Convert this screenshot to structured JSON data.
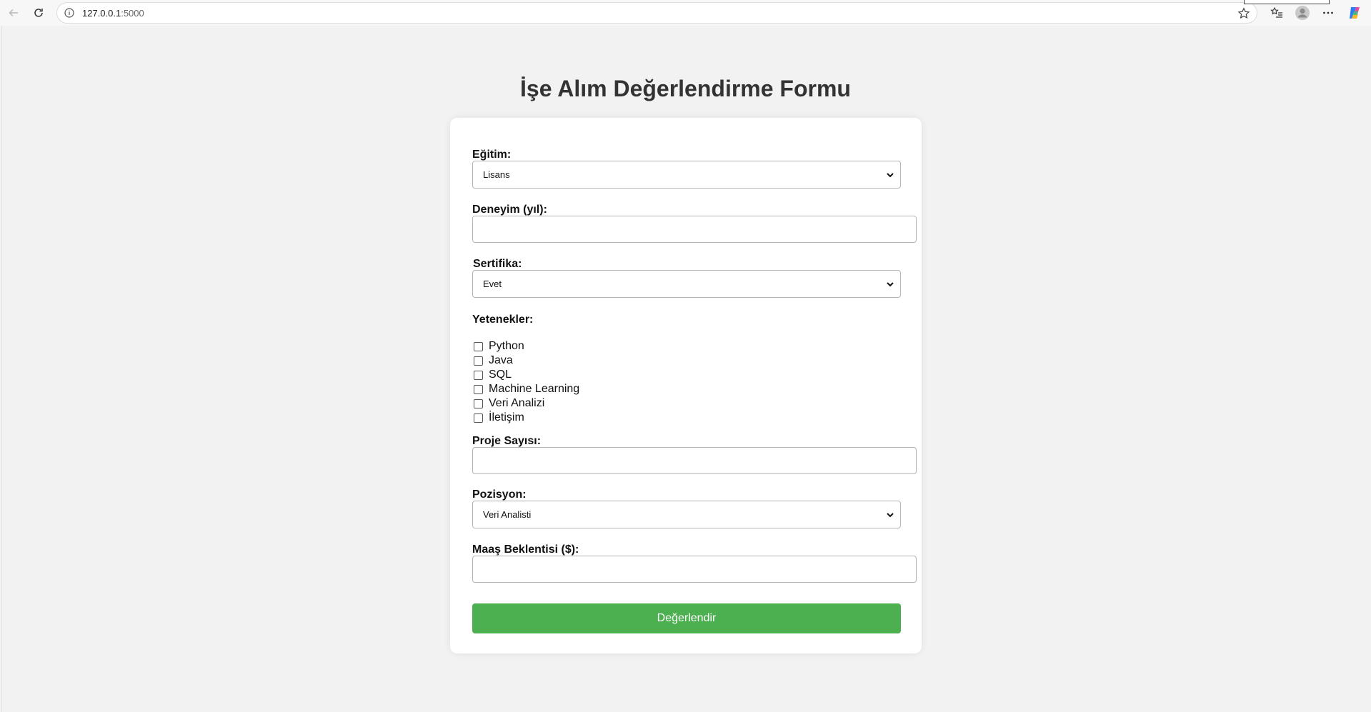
{
  "browser": {
    "url_host": "127.0.0.1",
    "url_port": ":5000"
  },
  "page": {
    "title": "İşe Alım Değerlendirme Formu"
  },
  "form": {
    "education_label": "Eğitim:",
    "education_value": "Lisans",
    "experience_label": "Deneyim (yıl):",
    "experience_value": "",
    "certificate_label": "Sertifika:",
    "certificate_value": "Evet",
    "skills_label": "Yetenekler:",
    "skills": [
      {
        "label": "Python",
        "checked": false
      },
      {
        "label": "Java",
        "checked": false
      },
      {
        "label": "SQL",
        "checked": false
      },
      {
        "label": "Machine Learning",
        "checked": false
      },
      {
        "label": "Veri Analizi",
        "checked": false
      },
      {
        "label": "İletişim",
        "checked": false
      }
    ],
    "projects_label": "Proje Sayısı:",
    "projects_value": "",
    "position_label": "Pozisyon:",
    "position_value": "Veri Analisti",
    "salary_label": "Maaş Beklentisi ($):",
    "salary_value": "",
    "submit_label": "Değerlendir"
  },
  "colors": {
    "submit_bg": "#4caf50",
    "page_bg": "#f2f2f2"
  }
}
